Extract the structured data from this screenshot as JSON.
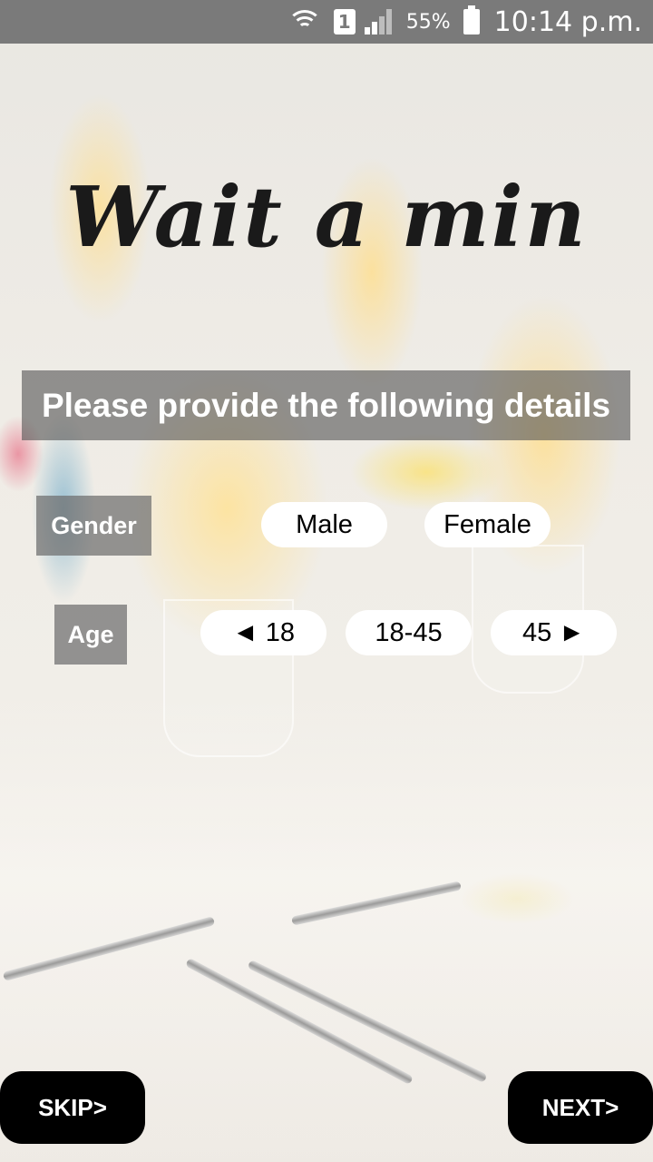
{
  "status_bar": {
    "sim_slot": "1",
    "battery_percent": "55%",
    "time": "10:14 p.m."
  },
  "title": "Wait a min",
  "instruction": "Please provide the following details",
  "gender": {
    "label": "Gender",
    "options": [
      "Male",
      "Female"
    ]
  },
  "age": {
    "label": "Age",
    "options": [
      "◄ 18",
      "18-45",
      "45 ►"
    ]
  },
  "buttons": {
    "skip": "SKIP>",
    "next": "NEXT>"
  }
}
